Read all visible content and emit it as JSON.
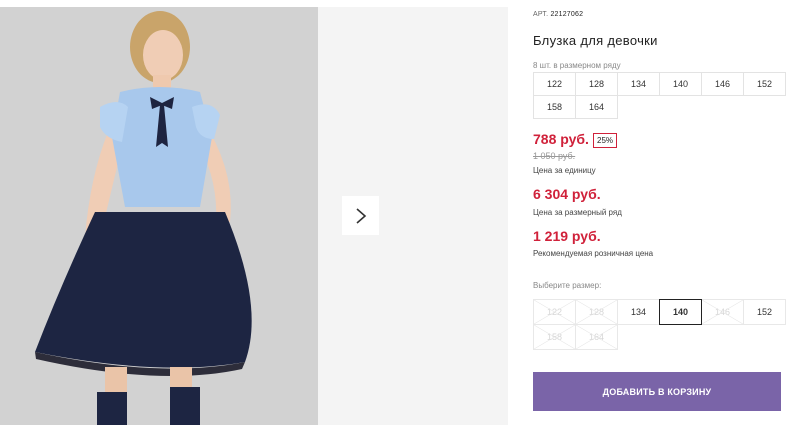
{
  "product": {
    "article_label": "АРТ.",
    "article_value": "22127062",
    "title": "Блузка для девочки"
  },
  "size_row": {
    "label": "8 шт. в размерном ряду",
    "sizes": [
      "122",
      "128",
      "134",
      "140",
      "146",
      "152",
      "158",
      "164"
    ]
  },
  "pricing": {
    "price": "788 руб.",
    "discount": "25%",
    "old_price": "1 050 руб.",
    "unit_caption": "Цена за единицу",
    "row_price": "6 304 руб.",
    "row_caption": "Цена за размерный ряд",
    "rrp": "1 219 руб.",
    "rrp_caption": "Рекомендуемая розничная цена"
  },
  "size_select": {
    "label": "Выберите размер:",
    "options": [
      {
        "label": "122",
        "state": "disabled"
      },
      {
        "label": "128",
        "state": "disabled"
      },
      {
        "label": "134",
        "state": "available"
      },
      {
        "label": "140",
        "state": "selected"
      },
      {
        "label": "146",
        "state": "disabled"
      },
      {
        "label": "152",
        "state": "available"
      },
      {
        "label": "158",
        "state": "disabled"
      },
      {
        "label": "164",
        "state": "disabled"
      }
    ]
  },
  "cart": {
    "button_label": "ДОБАВИТЬ В КОРЗИНУ"
  },
  "gallery": {
    "next_icon": "chevron-right-icon"
  },
  "colors": {
    "accent_price": "#d0213a",
    "button": "#7a64a8"
  }
}
